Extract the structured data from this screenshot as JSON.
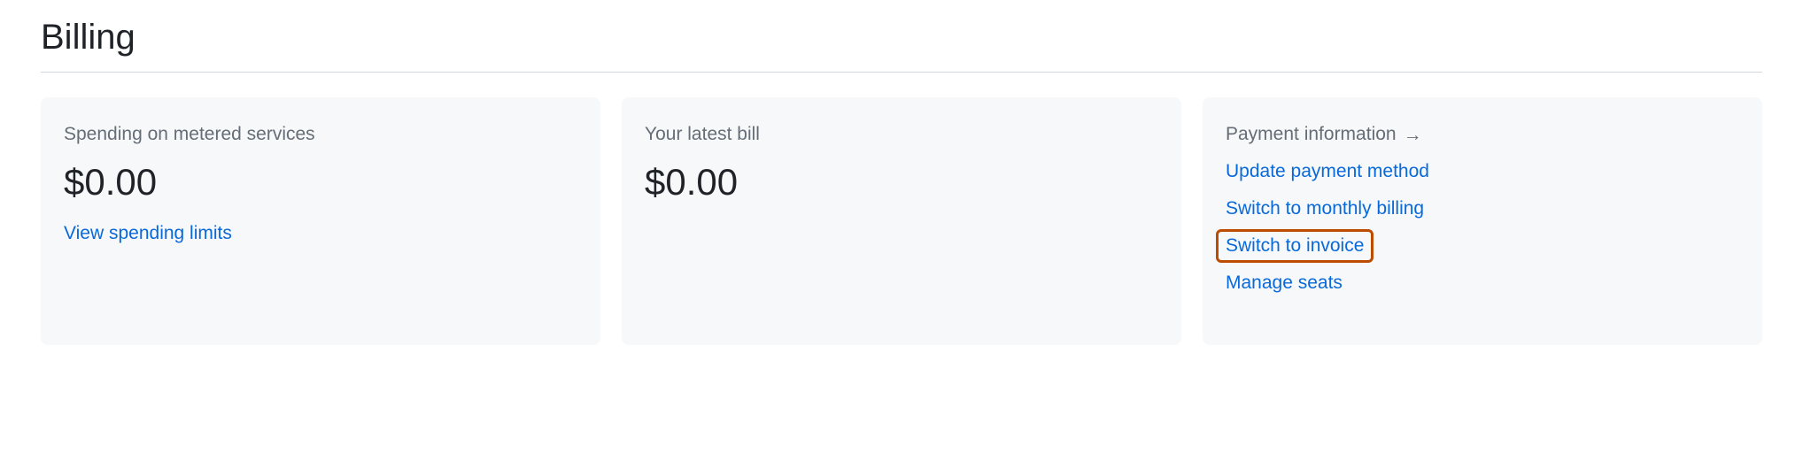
{
  "title": "Billing",
  "cards": {
    "spending": {
      "label": "Spending on metered services",
      "amount": "$0.00",
      "link": "View spending limits"
    },
    "latest_bill": {
      "label": "Your latest bill",
      "amount": "$0.00"
    },
    "payment_info": {
      "label": "Payment information",
      "links": {
        "update_payment": "Update payment method",
        "switch_monthly": "Switch to monthly billing",
        "switch_invoice": "Switch to invoice",
        "manage_seats": "Manage seats"
      }
    }
  }
}
